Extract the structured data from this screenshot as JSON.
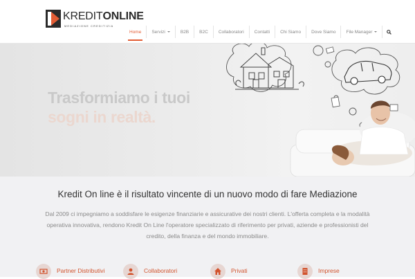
{
  "brand": {
    "name_part1": "KREDIT",
    "name_part2": "ONLINE",
    "tagline": "MEDIAZIONE CREDITIZIA",
    "accent": "#e35d35"
  },
  "nav": {
    "items": [
      {
        "label": "Home",
        "active": true
      },
      {
        "label": "Servizi",
        "dropdown": true
      },
      {
        "label": "B2B"
      },
      {
        "label": "B2C"
      },
      {
        "label": "Collaboratori"
      },
      {
        "label": "Contatti"
      },
      {
        "label": "Chi Siamo"
      },
      {
        "label": "Dove Siamo"
      },
      {
        "label": "File Manager",
        "dropdown": true
      }
    ],
    "search_icon": "search-icon"
  },
  "hero": {
    "line1": "Trasformiamo i tuoi",
    "line2": "sogni in realtà."
  },
  "intro": {
    "headline": "Kredit On line è il risultato vincente di un nuovo modo di fare Mediazione",
    "body": "Dal 2009 ci impegniamo a soddisfare le esigenze finanziarie e assicurative dei nostri clienti. L'offerta completa e la modalità operativa innovativa, rendono Kredit On Line l'operatore specializzato di riferimento per privati, aziende e professionisti del credito, della finanza e del mondo immobiliare."
  },
  "categories": [
    {
      "label": "Partner Distributivi",
      "icon": "money-icon"
    },
    {
      "label": "Collaboratori",
      "icon": "user-icon"
    },
    {
      "label": "Privati",
      "icon": "home-icon"
    },
    {
      "label": "Imprese",
      "icon": "building-icon"
    }
  ],
  "colors": {
    "accent": "#e35d35",
    "category_text": "#d2532d",
    "icon_circle": "#e7d6d2",
    "hero_line1": "#c9c9c9",
    "hero_line2": "#ebd7cf"
  }
}
